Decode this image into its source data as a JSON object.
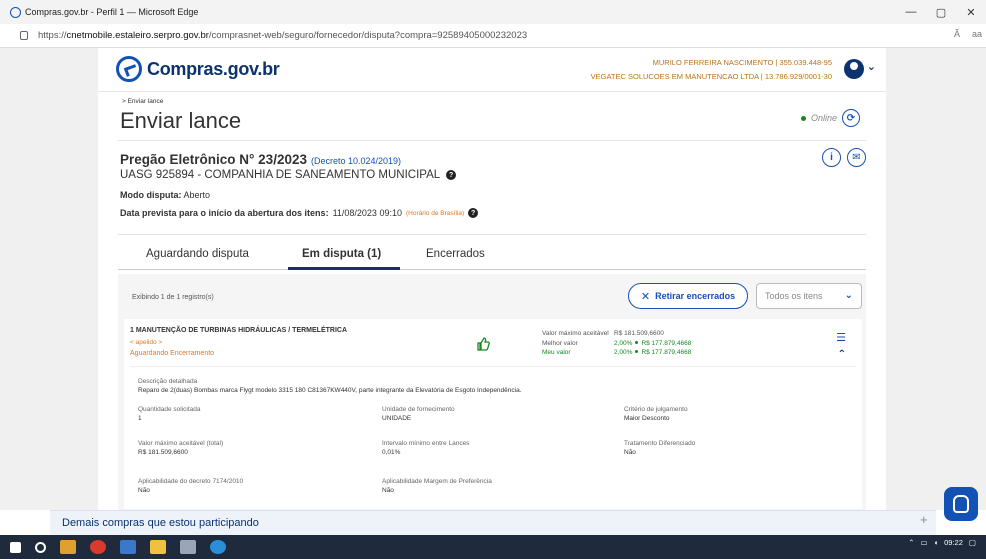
{
  "window": {
    "title": "Compras.gov.br - Perfil 1 — Microsoft Edge",
    "controls": [
      "—",
      "▢",
      "✕"
    ]
  },
  "address": {
    "prefix": "https://",
    "host": "cnetmobile.estaleiro.serpro.gov.br",
    "path": "/comprasnet-web/seguro/fornecedor/disputa?compra=92589405000232023",
    "right_icons": [
      "Ã",
      "aa"
    ]
  },
  "header": {
    "logo_text": "Compras.gov.br",
    "user_name": "MURILO FERREIRA NASCIMENTO | 355.039.448-95",
    "company": "VEGATEC SOLUCOES EM MANUTENCAO LTDA | 13.786.929/0001-30"
  },
  "breadcrumb": "> Enviar lance",
  "page_title": "Enviar lance",
  "status": {
    "online_label": "Online"
  },
  "pregao": {
    "title": "Pregão Eletrônico N° 23/2023",
    "decreto": "(Decreto 10.024/2019)",
    "uasg": "UASG 925894 - COMPANHIA DE SANEAMENTO MUNICIPAL",
    "modo_label": "Modo disputa:",
    "modo_value": "Aberto",
    "data_label": "Data prevista para o início da abertura dos itens:",
    "data_value": "11/08/2023 09:10",
    "timezone": "(Horário de Brasília)"
  },
  "tabs": [
    {
      "label": "Aguardando disputa"
    },
    {
      "label": "Em disputa (1)"
    },
    {
      "label": "Encerrados"
    }
  ],
  "list": {
    "exibindo": "Exibindo 1 de 1 registro(s)",
    "retirar_label": "Retirar encerrados",
    "filter_value": "Todos os itens"
  },
  "item": {
    "title": "1  MANUTENÇÃO DE TURBINAS HIDRÁULICAS / TERMELÉTRICA",
    "link": "< apelido >",
    "status": "Aguardando Encerramento",
    "valor_max_label": "Valor máximo aceitável",
    "valor_max_value": "R$ 181.509,6600",
    "melhor_label": "Melhor valor",
    "melhor_pct": "2,00%",
    "melhor_value": "R$ 177.879,4668",
    "meu_label": "Meu valor",
    "meu_pct": "2,00%",
    "meu_value": "R$ 177.879,4668",
    "descricao_label": "Descrição detalhada",
    "descricao_value": "Reparo de 2(duas) Bombas marca Flygt modelo 3315 180 C81367KW440V, parte integrante da Elevatória de Esgoto Independência.",
    "qtd_label": "Quantidade solicitada",
    "qtd_value": "1",
    "unidade_label": "Unidade de fornecimento",
    "unidade_value": "UNIDADE",
    "criterio_label": "Critério de julgamento",
    "criterio_value": "Maior Desconto",
    "vmax_total_label": "Valor máximo aceitável (total)",
    "vmax_total_value": "R$ 181.509,6600",
    "intervalo_label": "Intervalo mínimo entre Lances",
    "intervalo_value": "0,01%",
    "tratamento_label": "Tratamento Diferenciado",
    "tratamento_value": "Não",
    "aplic_decreto_label": "Aplicabilidade do decreto 7174/2010",
    "aplic_decreto_value": "Não",
    "aplic_margem_label": "Aplicabilidade Margem de Preferência",
    "aplic_margem_value": "Não"
  },
  "bottom_bar": "Demais compras que estou participando",
  "taskbar": {
    "time": "09:22"
  }
}
